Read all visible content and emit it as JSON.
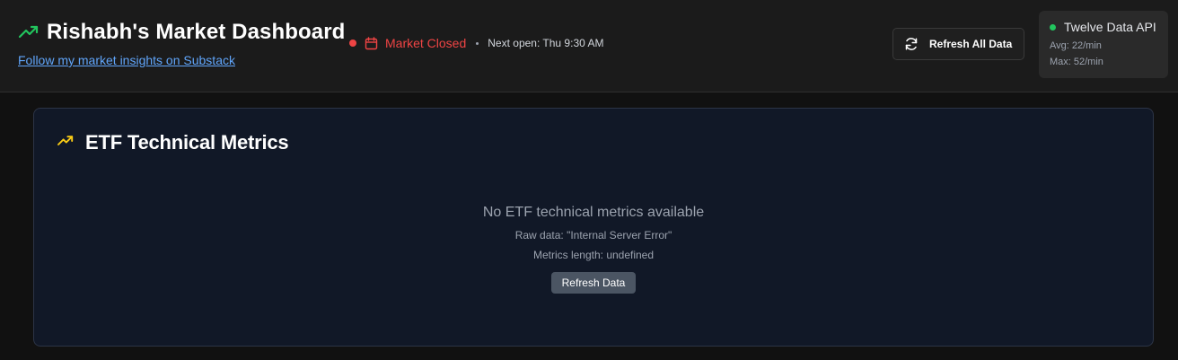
{
  "header": {
    "title": "Rishabh's Market Dashboard",
    "substack_link": "Follow my market insights on Substack",
    "market_status": "Market Closed",
    "next_open": "Next open: Thu 9:30 AM",
    "refresh_all_label": "Refresh All Data",
    "icons": {
      "title_icon": "trending-up-icon",
      "status_dot": "status-dot",
      "calendar": "calendar-icon",
      "refresh": "refresh-icon"
    }
  },
  "api": {
    "name": "Twelve Data API",
    "avg": "Avg: 22/min",
    "max": "Max: 52/min"
  },
  "etf_card": {
    "title": "ETF Technical Metrics",
    "empty_title": "No ETF technical metrics available",
    "raw_data": "Raw data: \"Internal Server Error\"",
    "metrics_length": "Metrics length: undefined",
    "refresh_label": "Refresh Data"
  },
  "colors": {
    "accent_green": "#22c55e",
    "accent_yellow": "#facc15",
    "status_red": "#ef4444",
    "link_blue": "#60a5fa"
  }
}
